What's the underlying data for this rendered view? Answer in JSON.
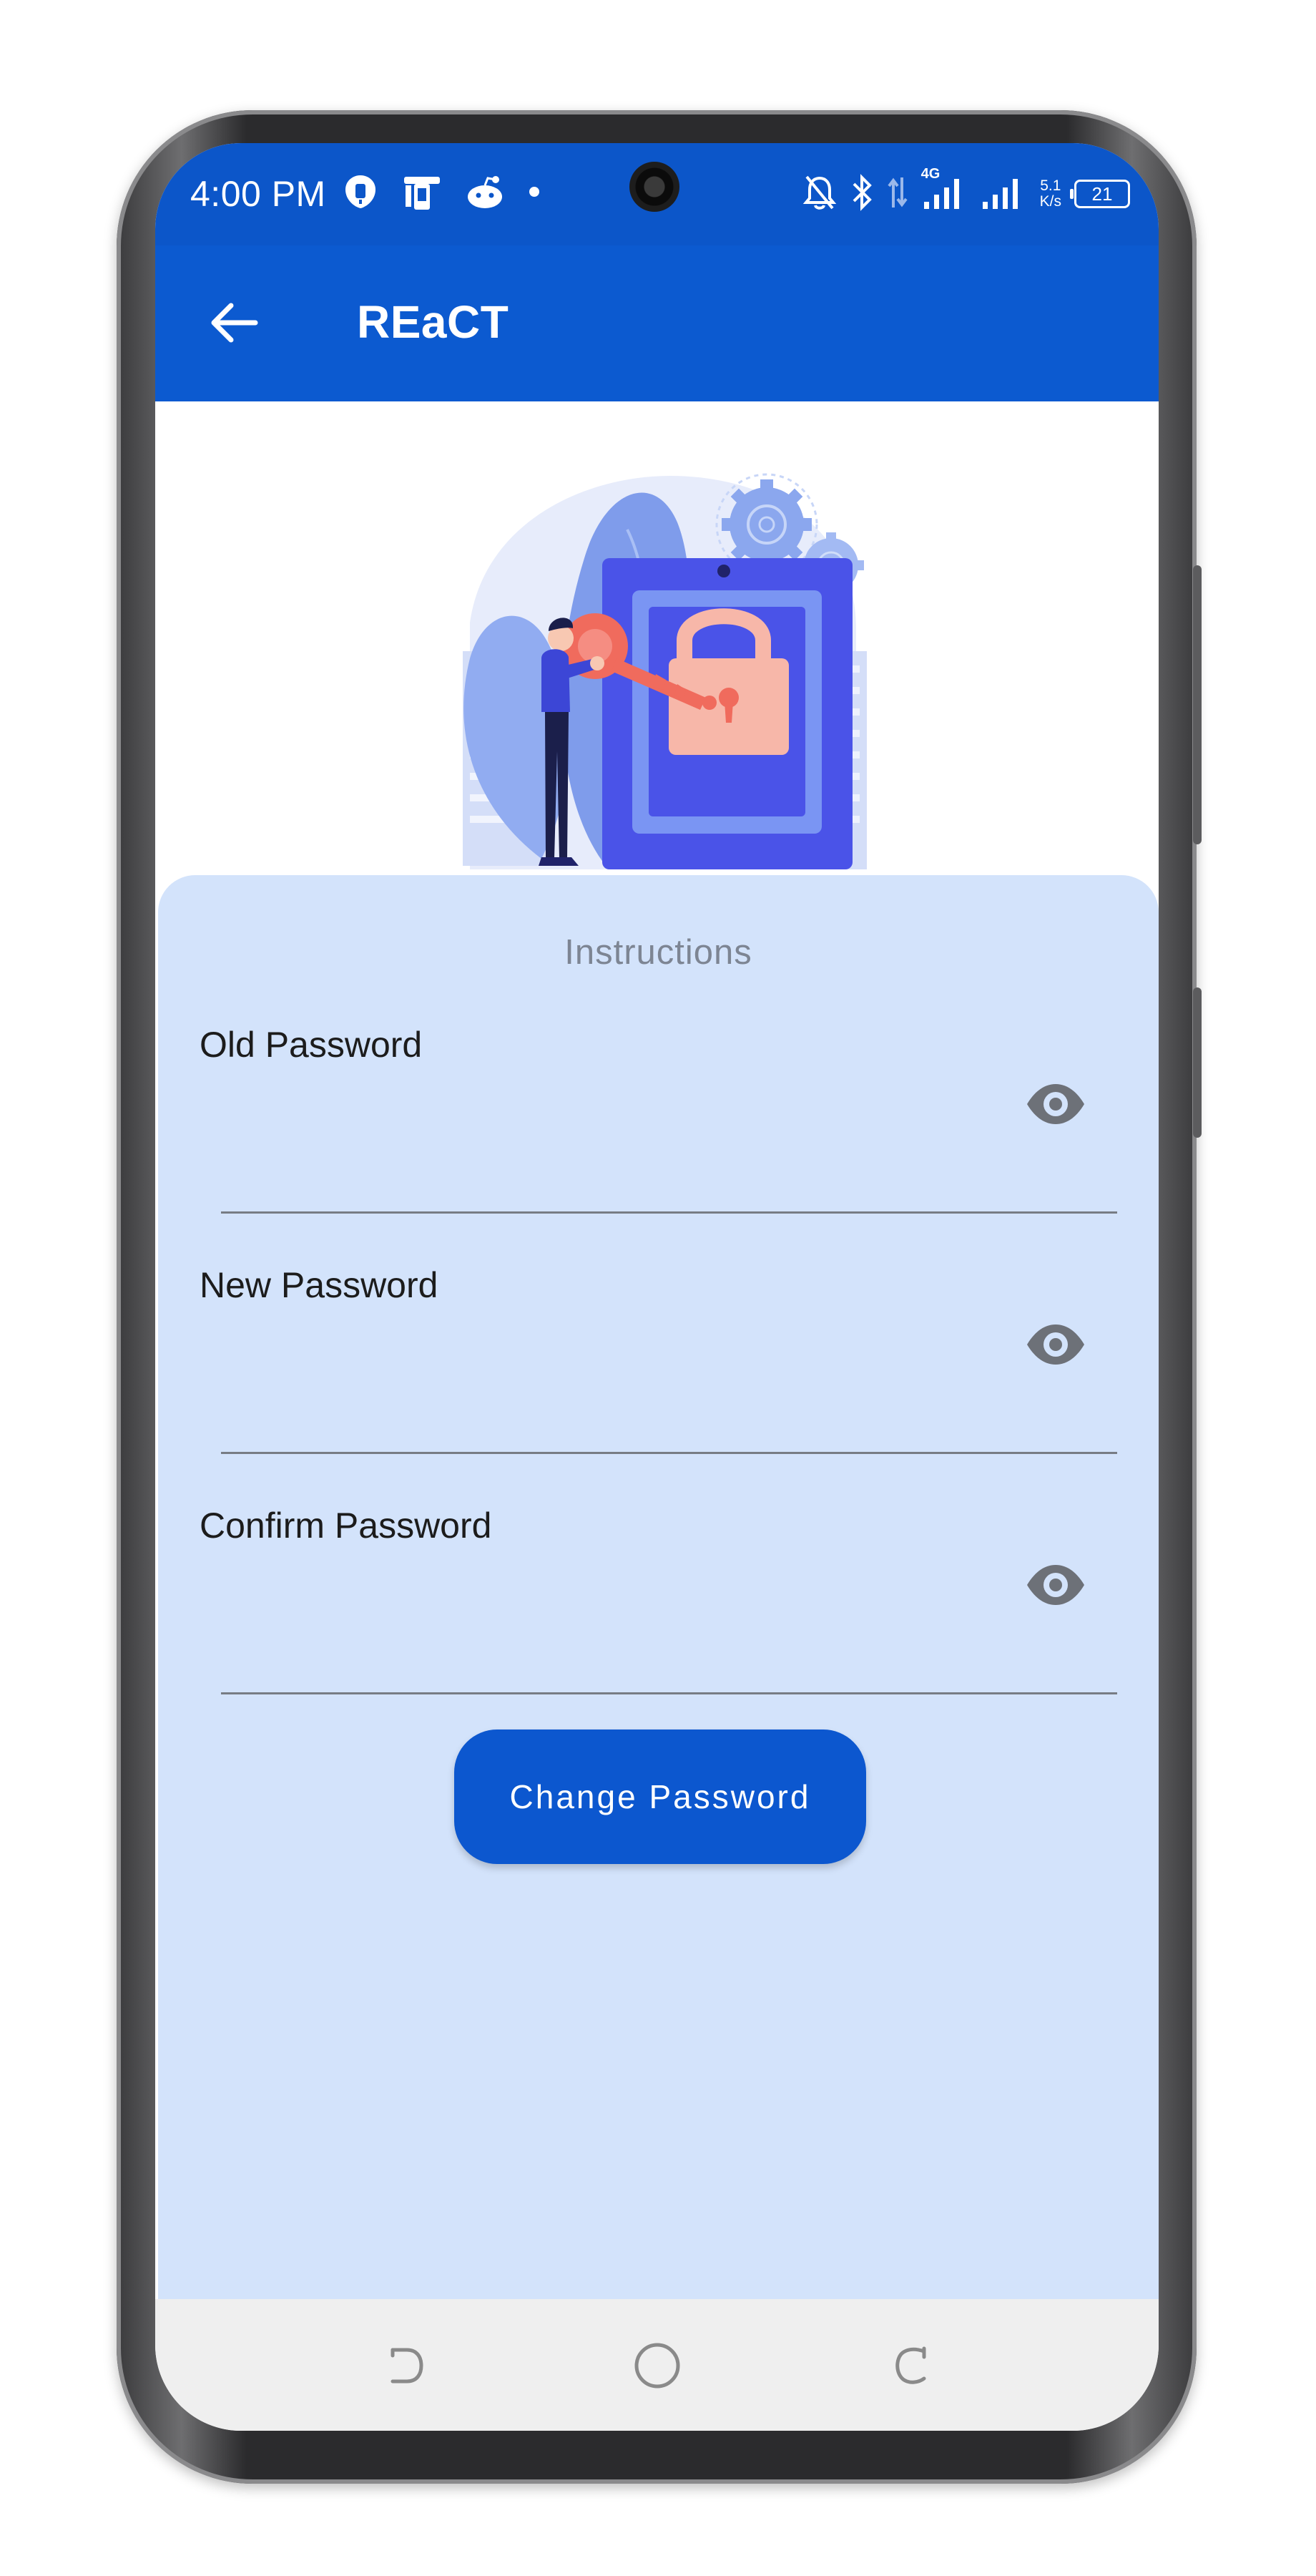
{
  "status_bar": {
    "time": "4:00 PM",
    "left_icons": [
      "shield-app-icon",
      "device-app-icon",
      "reddit-icon",
      "more-dot-icon"
    ],
    "right_icons": [
      "bell-off-icon",
      "bluetooth-icon",
      "data-arrows-icon",
      "signal-icon",
      "signal-icon"
    ],
    "network_label": "4G",
    "speed_value": "5.1",
    "speed_unit": "K/s",
    "battery": "21"
  },
  "app_bar": {
    "back_icon": "arrow-left-icon",
    "title": "REaCT"
  },
  "illustration": {
    "subject": "person-holding-key-at-padlock-door"
  },
  "form": {
    "instructions": "Instructions",
    "fields": [
      {
        "label": "Old Password",
        "value": "",
        "icon": "eye-icon"
      },
      {
        "label": "New Password",
        "value": "",
        "icon": "eye-icon"
      },
      {
        "label": "Confirm Password",
        "value": "",
        "icon": "eye-icon"
      }
    ],
    "submit_label": "Change Password"
  },
  "nav_bar": {
    "icons": [
      "recents-icon",
      "home-icon",
      "back-nav-icon"
    ]
  },
  "colors": {
    "primary": "#0c5ad0",
    "card_background": "#d3e3fb",
    "nav_background": "#efefef"
  }
}
